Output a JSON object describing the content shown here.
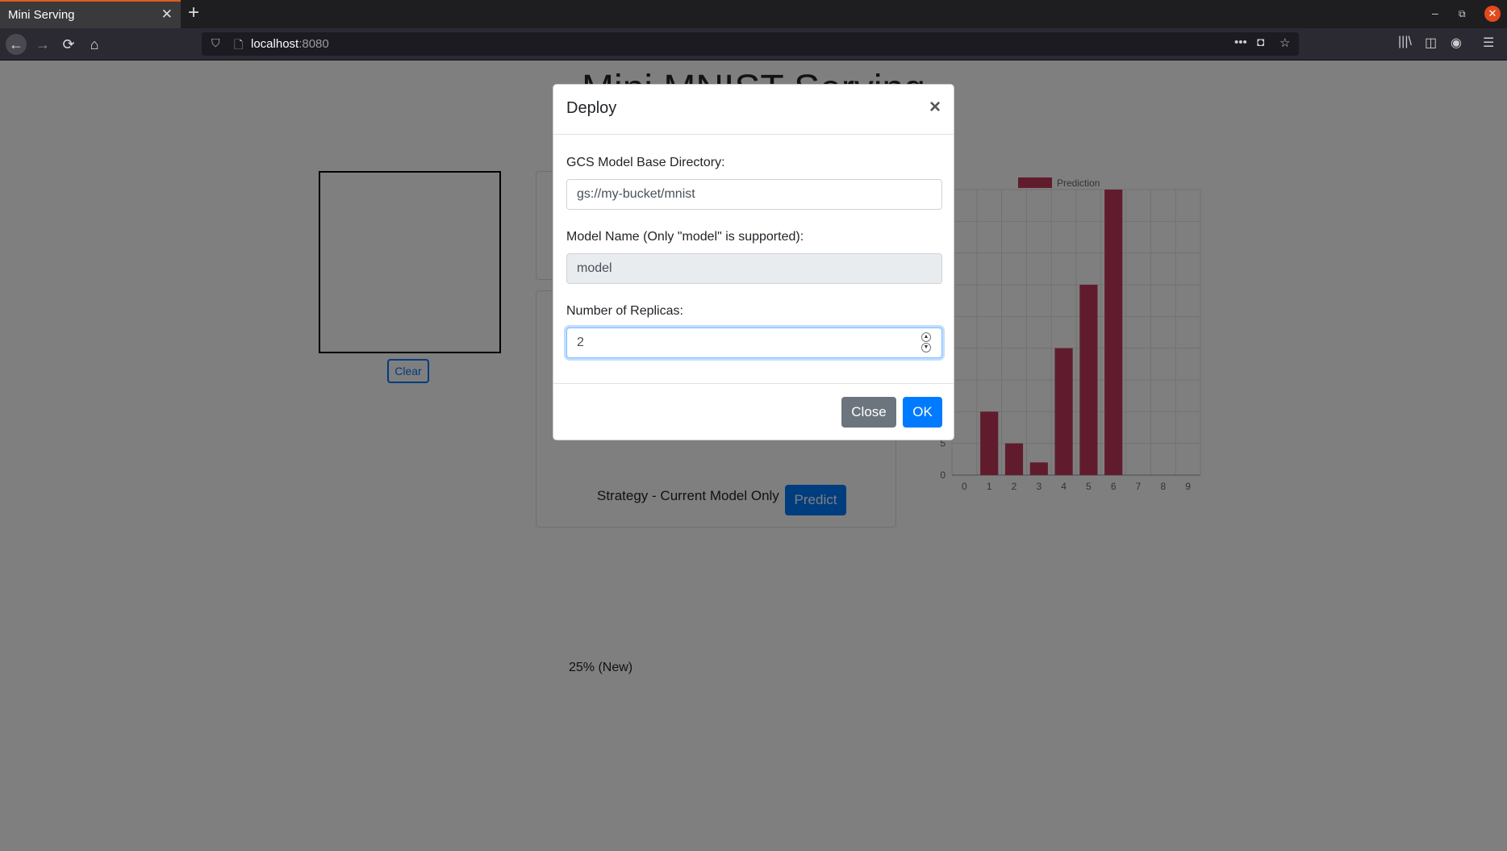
{
  "browser": {
    "tab_title": "Mini Serving",
    "tab_close": "✕",
    "new_tab": "+",
    "url_host": "localhost",
    "url_port": ":8080",
    "window_controls": {
      "minimize": "–",
      "maximize": "⧉",
      "close": "✕"
    }
  },
  "page": {
    "title": "Mini MNIST Serving",
    "clear_label": "Clear",
    "card_text": "25% (New)",
    "strategy_label": "Strategy - Current Model Only",
    "predict_label": "Predict"
  },
  "chart_data": {
    "type": "bar",
    "legend": "Prediction",
    "categories": [
      "0",
      "1",
      "2",
      "3",
      "4",
      "5",
      "6",
      "7",
      "8",
      "9"
    ],
    "values": [
      0,
      10,
      5,
      2,
      20,
      30,
      45,
      0,
      0,
      0
    ],
    "yticks_visible": [
      "0",
      "5"
    ],
    "ylim": [
      0,
      45
    ],
    "color": "#c0395a",
    "grid": true,
    "legend_position": "top"
  },
  "modal": {
    "title": "Deploy",
    "close_x": "×",
    "fields": [
      {
        "label": "GCS Model Base Directory:",
        "value": "gs://my-bucket/mnist"
      },
      {
        "label": "Model Name (Only \"model\" is supported):",
        "value": "model"
      },
      {
        "label": "Number of Replicas:",
        "value": "2"
      }
    ],
    "close_label": "Close",
    "ok_label": "OK"
  },
  "icons": {
    "back": "←",
    "forward": "→",
    "reload": "⟳",
    "home": "⌂",
    "shield": "⛉",
    "page": "🗋",
    "more": "•••",
    "pocket": "◘",
    "star": "☆",
    "library": "|||\\",
    "sidebar": "◫",
    "account": "◉",
    "menu": "☰",
    "spin_up": "▲",
    "spin_down": "▼"
  },
  "colors": {
    "accent": "#007bff",
    "secondary": "#6c757d",
    "tab_indicator": "#e35a1d"
  }
}
